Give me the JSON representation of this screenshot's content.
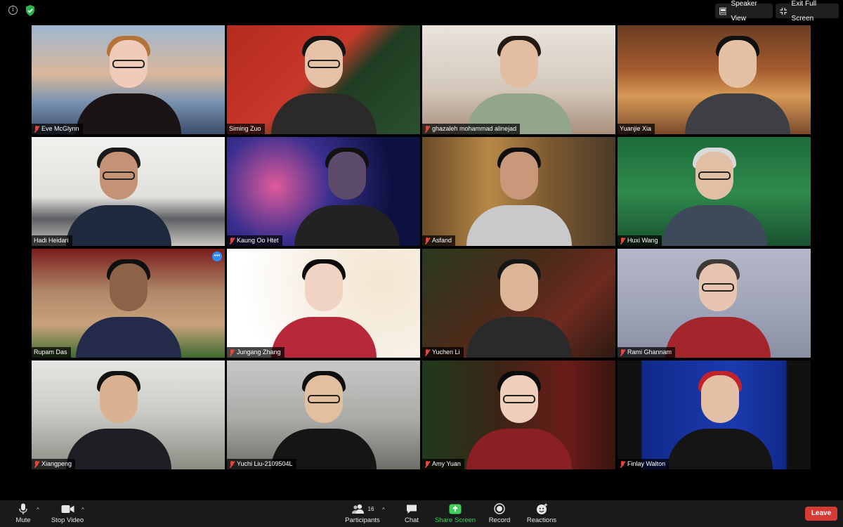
{
  "top_bar": {
    "speaker_view_label": "Speaker View",
    "exit_full_screen_label": "Exit Full Screen",
    "info_icon": "info-icon",
    "security_icon": "shield-check-icon",
    "security_color": "#2bb24c"
  },
  "participants": [
    {
      "name": "Eve McGlynn",
      "muted": true
    },
    {
      "name": "Siming Zuo",
      "muted": false,
      "active_speaker": true
    },
    {
      "name": "ghazaleh mohammad alinejad",
      "muted": true
    },
    {
      "name": "Yuanjie Xia",
      "muted": false
    },
    {
      "name": "Hadi Heidari",
      "muted": false
    },
    {
      "name": "Kaung Oo Htet",
      "muted": true
    },
    {
      "name": "Asfand",
      "muted": true
    },
    {
      "name": "Huxi Wang",
      "muted": true
    },
    {
      "name": "Rupam Das",
      "muted": false
    },
    {
      "name": "Jungang Zhang",
      "muted": true
    },
    {
      "name": "Yuchen Li",
      "muted": true
    },
    {
      "name": "Rami Ghannam",
      "muted": true
    },
    {
      "name": "Xiangpeng",
      "muted": true
    },
    {
      "name": "Yuchi Liu-2109504L",
      "muted": true
    },
    {
      "name": "Amy Yuan",
      "muted": true
    },
    {
      "name": "Finlay Walton",
      "muted": true
    }
  ],
  "toolbar": {
    "mute_label": "Mute",
    "stop_video_label": "Stop Video",
    "participants_label": "Participants",
    "participants_count": "16",
    "chat_label": "Chat",
    "share_screen_label": "Share Screen",
    "record_label": "Record",
    "reactions_label": "Reactions",
    "leave_label": "Leave",
    "share_color": "#3fd05a",
    "leave_color": "#d53a35"
  }
}
